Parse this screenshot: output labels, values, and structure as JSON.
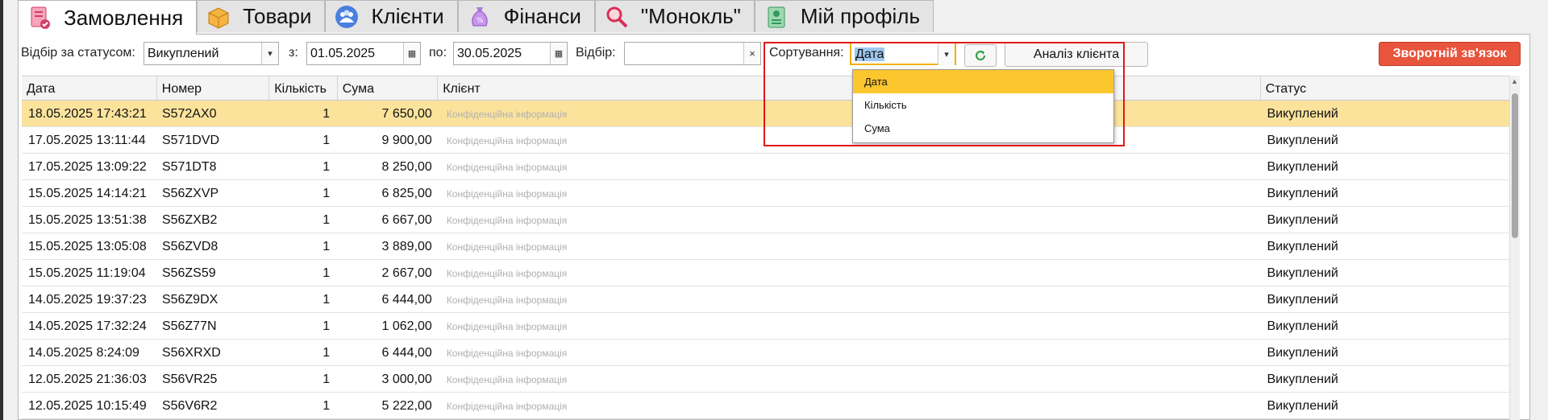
{
  "tabs": [
    {
      "label": "Замовлення",
      "icon": "orders-icon",
      "active": true
    },
    {
      "label": "Товари",
      "icon": "box-icon",
      "active": false
    },
    {
      "label": "Клієнти",
      "icon": "clients-icon",
      "active": false
    },
    {
      "label": "Фінанси",
      "icon": "money-bag-icon",
      "active": false
    },
    {
      "label": "\"Монокль\"",
      "icon": "magnifier-icon",
      "active": false
    },
    {
      "label": "Мій профіль",
      "icon": "profile-icon",
      "active": false
    }
  ],
  "toolbar": {
    "status_label": "Відбір за статусом:",
    "status_value": "Викуплений",
    "from_label": "з:",
    "from_date": "01.05.2025",
    "to_label": "по:",
    "to_date": "30.05.2025",
    "filter_label": "Відбір:",
    "filter_value": "",
    "clear_glyph": "×",
    "sort_label": "Сортування:",
    "sort_value": "Дата",
    "analyze_label": "Аналіз клієнта",
    "feedback_label": "Зворотній зв'язок"
  },
  "sort_options": [
    "Дата",
    "Кількість",
    "Сума"
  ],
  "table": {
    "columns": [
      "Дата",
      "Номер",
      "Кількість",
      "Сума",
      "Клієнт",
      "",
      "Статус"
    ],
    "client_placeholder": "Конфіденційна інформація",
    "rows": [
      {
        "date": "18.05.2025 17:43:21",
        "num": "S572AX0",
        "qty": "1",
        "sum": "7 650,00",
        "status": "Викуплений"
      },
      {
        "date": "17.05.2025 13:11:44",
        "num": "S571DVD",
        "qty": "1",
        "sum": "9 900,00",
        "status": "Викуплений"
      },
      {
        "date": "17.05.2025 13:09:22",
        "num": "S571DT8",
        "qty": "1",
        "sum": "8 250,00",
        "status": "Викуплений"
      },
      {
        "date": "15.05.2025 14:14:21",
        "num": "S56ZXVP",
        "qty": "1",
        "sum": "6 825,00",
        "status": "Викуплений"
      },
      {
        "date": "15.05.2025 13:51:38",
        "num": "S56ZXB2",
        "qty": "1",
        "sum": "6 667,00",
        "status": "Викуплений"
      },
      {
        "date": "15.05.2025 13:05:08",
        "num": "S56ZVD8",
        "qty": "1",
        "sum": "3 889,00",
        "status": "Викуплений"
      },
      {
        "date": "15.05.2025 11:19:04",
        "num": "S56ZS59",
        "qty": "1",
        "sum": "2 667,00",
        "status": "Викуплений"
      },
      {
        "date": "14.05.2025 19:37:23",
        "num": "S56Z9DX",
        "qty": "1",
        "sum": "6 444,00",
        "status": "Викуплений"
      },
      {
        "date": "14.05.2025 17:32:24",
        "num": "S56Z77N",
        "qty": "1",
        "sum": "1 062,00",
        "status": "Викуплений"
      },
      {
        "date": "14.05.2025 8:24:09",
        "num": "S56XRXD",
        "qty": "1",
        "sum": "6 444,00",
        "status": "Викуплений"
      },
      {
        "date": "12.05.2025 21:36:03",
        "num": "S56VR25",
        "qty": "1",
        "sum": "3 000,00",
        "status": "Викуплений"
      },
      {
        "date": "12.05.2025 10:15:49",
        "num": "S56V6R2",
        "qty": "1",
        "sum": "5 222,00",
        "status": "Викуплений"
      }
    ]
  },
  "colors": {
    "accent": "#fcc62e",
    "selected_row": "#fbe39c",
    "feedback": "#e8543c",
    "highlight": "#e01818"
  }
}
